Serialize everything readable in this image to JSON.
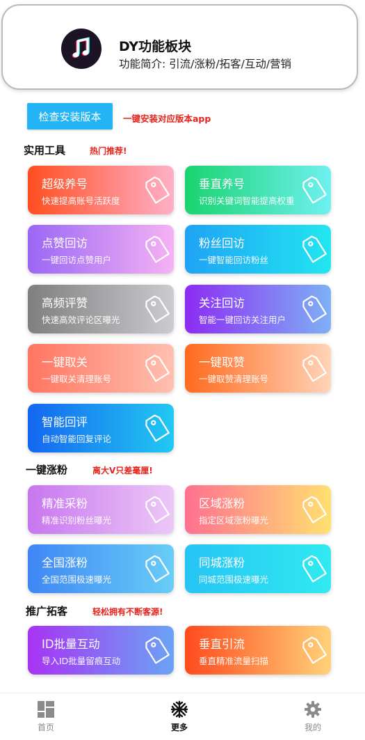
{
  "header": {
    "title": "DY功能板块",
    "description": "功能简介: 引流/涨粉/拓客/互动/营销",
    "logo_icon": "music-note-icon"
  },
  "install": {
    "button_label": "检查安装版本",
    "note": "一键安装对应版本app"
  },
  "sections": [
    {
      "title": "实用工具",
      "note": "热门推荐!",
      "cards": [
        {
          "title": "超级养号",
          "subtitle": "快速提高账号活跃度",
          "gradient": [
            "#ff4e20",
            "#ffb0c8"
          ]
        },
        {
          "title": "垂直养号",
          "subtitle": "识别关键词智能提高权重",
          "gradient": [
            "#19d46f",
            "#6ff0f0"
          ]
        },
        {
          "title": "点赞回访",
          "subtitle": "一键回访点赞用户",
          "gradient": [
            "#9a67f5",
            "#f6b2f4"
          ]
        },
        {
          "title": "粉丝回访",
          "subtitle": "一键智能回访粉丝",
          "gradient": [
            "#1fa3f5",
            "#22e6f0"
          ]
        },
        {
          "title": "高频评赞",
          "subtitle": "快速高效评论区曝光",
          "gradient": [
            "#7f7f7f",
            "#cbcbd0"
          ]
        },
        {
          "title": "关注回访",
          "subtitle": "智能一键回访关注用户",
          "gradient": [
            "#8c2cf3",
            "#7eb0f5"
          ]
        },
        {
          "title": "一键取关",
          "subtitle": "一键取关清理账号",
          "gradient": [
            "#ff7561",
            "#ffc0b0"
          ]
        },
        {
          "title": "一键取赞",
          "subtitle": "一键取赞清理账号",
          "gradient": [
            "#ff6a1e",
            "#ffd4b8"
          ]
        },
        {
          "title": "智能回评",
          "subtitle": "自动智能回复评论",
          "gradient": [
            "#1467f0",
            "#22c8f2"
          ]
        }
      ]
    },
    {
      "title": "一键涨粉",
      "note": "离大V只差毫厘!",
      "cards": [
        {
          "title": "精准采粉",
          "subtitle": "精准识别粉丝曝光",
          "gradient": [
            "#c876f0",
            "#ecc8f6"
          ]
        },
        {
          "title": "区域涨粉",
          "subtitle": "指定区域涨粉曝光",
          "gradient": [
            "#ff7090",
            "#ffe070"
          ]
        },
        {
          "title": "全国涨粉",
          "subtitle": "全国范围极速曝光",
          "gradient": [
            "#3f86f5",
            "#68cdf6"
          ]
        },
        {
          "title": "同城涨粉",
          "subtitle": "同城范围极速曝光",
          "gradient": [
            "#26c4f5",
            "#30eaf0"
          ]
        }
      ]
    },
    {
      "title": "推广拓客",
      "note": "轻松拥有不断客源!",
      "cards": [
        {
          "title": "ID批量互动",
          "subtitle": "导入ID批量留痕互动",
          "gradient": [
            "#a833f3",
            "#6ba3f5"
          ]
        },
        {
          "title": "垂直引流",
          "subtitle": "垂直精准流量扫描",
          "gradient": [
            "#ff4a1c",
            "#ffd27a"
          ]
        }
      ]
    }
  ],
  "nav": [
    {
      "label": "首页",
      "icon": "grid-icon",
      "active": false
    },
    {
      "label": "更多",
      "icon": "snowflake-icon",
      "active": true
    },
    {
      "label": "我的",
      "icon": "gear-icon",
      "active": false
    }
  ]
}
